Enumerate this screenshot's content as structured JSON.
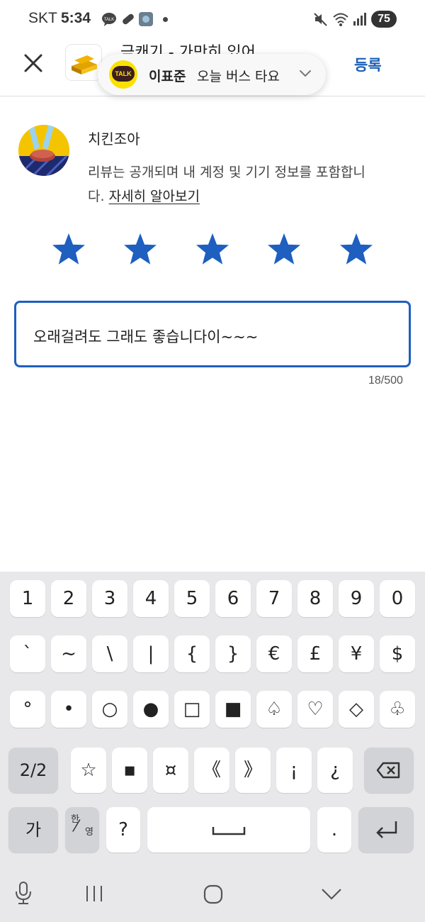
{
  "status_bar": {
    "carrier": "SKT",
    "time": "5:34",
    "battery": "75",
    "icons": [
      "talk-icon",
      "pill-icon",
      "game-app-icon",
      "mute-icon",
      "wifi-icon",
      "signal-icon"
    ]
  },
  "app_bar": {
    "title": "금캐기 - 가만히 있어",
    "submit_label": "등록"
  },
  "notification": {
    "app": "TALK",
    "sender": "이표준",
    "message": "오늘 버스 타요"
  },
  "reviewer": {
    "name": "치킨조아",
    "disclaimer": "리뷰는 공개되며 내 계정 및 기기 정보를 포함합니다.",
    "learn_more": "자세히 알아보기"
  },
  "rating": {
    "value": 5,
    "max": 5
  },
  "review": {
    "text": "오래걸려도 그래도 좋습니다이~~~",
    "counter": "18/500"
  },
  "keyboard": {
    "row1": [
      "1",
      "2",
      "3",
      "4",
      "5",
      "6",
      "7",
      "8",
      "9",
      "0"
    ],
    "row2": [
      "`",
      "~",
      "\\",
      "|",
      "{",
      "}",
      "€",
      "£",
      "¥",
      "$"
    ],
    "row3": [
      "°",
      "•",
      "○",
      "●",
      "□",
      "■",
      "♤",
      "♡",
      "◇",
      "♧"
    ],
    "row4": [
      "☆",
      "▪",
      "¤",
      "《",
      "》",
      "¡",
      "¿"
    ],
    "page_label": "2/2",
    "lang_label": "가",
    "toggle_top": "한",
    "toggle_bottom": "영",
    "question": "?",
    "period": ".",
    "accent": "#1e5fbf"
  }
}
